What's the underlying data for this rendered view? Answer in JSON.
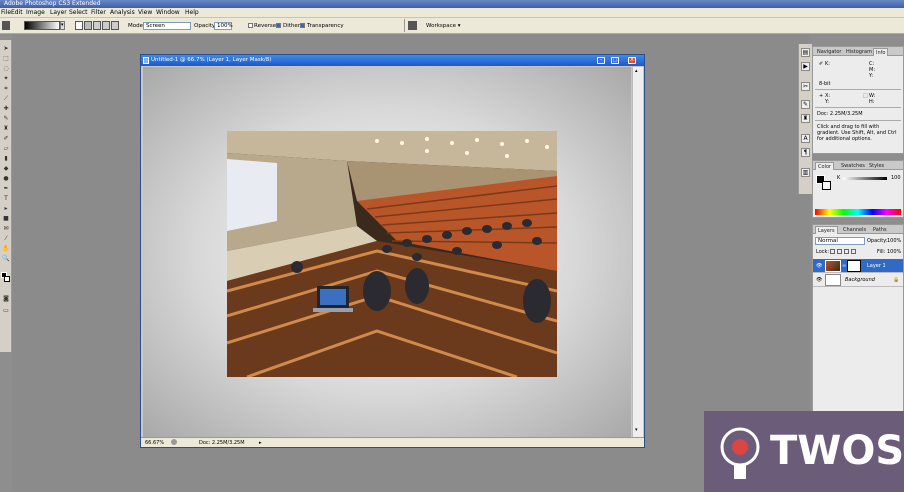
{
  "app": {
    "title": "Adobe Photoshop CS3 Extended"
  },
  "menu": [
    "File",
    "Edit",
    "Image",
    "Layer",
    "Select",
    "Filter",
    "Analysis",
    "View",
    "Window",
    "Help"
  ],
  "options": {
    "mode_label": "Mode:",
    "mode_value": "Screen",
    "opacity_label": "Opacity:",
    "opacity_value": "100%",
    "reverse": "Reverse",
    "dither": "Dither",
    "transparency": "Transparency",
    "workspace": "Workspace ▾"
  },
  "document": {
    "title": "Untitled-1 @ 66.7% (Layer 1, Layer Mask/8)",
    "zoom": "66.67%",
    "doc_size": "Doc: 2.25M/3.25M"
  },
  "info_panel": {
    "tabs": [
      "Navigator",
      "Histogram",
      "Info"
    ],
    "k_label": "K:",
    "c_label": "C:",
    "m_label": "M:",
    "y_label": "Y:",
    "bit": "8-bit",
    "x_label": "X:",
    "y2_label": "Y:",
    "w_label": "W:",
    "h_label": "H:",
    "doc": "Doc: 2.25M/3.25M",
    "hint": "Click and drag to fill with gradient. Use Shift, Alt, and Ctrl for additional options."
  },
  "color_panel": {
    "tabs": [
      "Color",
      "Swatches",
      "Styles"
    ],
    "k_label": "K",
    "k_value": "100"
  },
  "layers_panel": {
    "tabs": [
      "Layers",
      "Channels",
      "Paths"
    ],
    "blend": "Normal",
    "opacity_label": "Opacity:",
    "opacity_value": "100%",
    "lock_label": "Lock:",
    "fill_label": "Fill:",
    "fill_value": "100%",
    "layers": [
      {
        "name": "Layer 1",
        "selected": true
      },
      {
        "name": "Background",
        "selected": false
      }
    ]
  },
  "watermark": {
    "text": "TWOS"
  },
  "colors": {
    "selection": "#316ac5",
    "title": "#1f57c8",
    "watermark_bg": "#6b5c7a"
  }
}
